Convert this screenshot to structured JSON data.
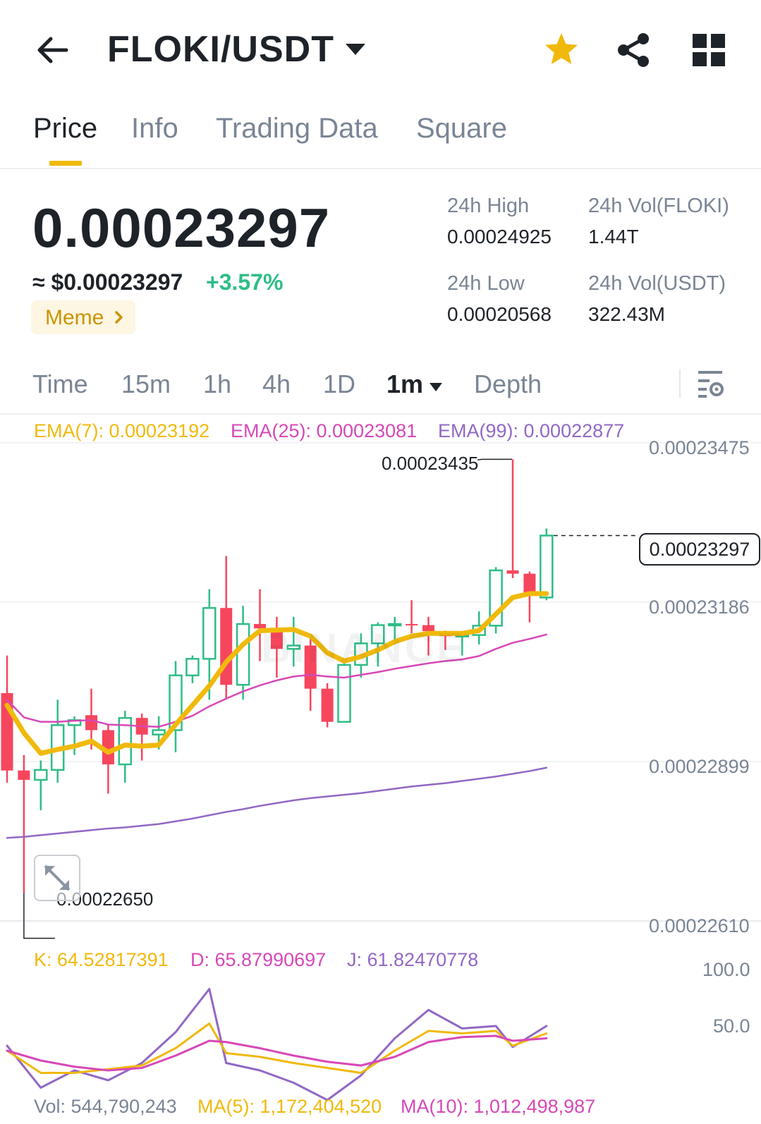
{
  "header": {
    "pair": "FLOKI/USDT",
    "icons": {
      "back": "arrow-left-icon",
      "caret": "caret-down-icon",
      "favorite": "star-icon",
      "share": "share-icon",
      "menu": "grid-icon"
    },
    "favorite_color": "#F0B90B"
  },
  "tabs": [
    {
      "label": "Price",
      "active": true
    },
    {
      "label": "Info",
      "active": false
    },
    {
      "label": "Trading Data",
      "active": false
    },
    {
      "label": "Square",
      "active": false
    }
  ],
  "ticker": {
    "last_price": "0.00023297",
    "fiat_price": "≈ $0.00023297",
    "change": "+3.57%",
    "tag": "Meme",
    "high_label": "24h High",
    "high_value": "0.00024925",
    "low_label": "24h Low",
    "low_value": "0.00020568",
    "vol_base_label": "24h Vol(FLOKI)",
    "vol_base_value": "1.44T",
    "vol_quote_label": "24h Vol(USDT)",
    "vol_quote_value": "322.43M"
  },
  "intervals": [
    {
      "label": "Time",
      "active": false
    },
    {
      "label": "15m",
      "active": false
    },
    {
      "label": "1h",
      "active": false
    },
    {
      "label": "4h",
      "active": false
    },
    {
      "label": "1D",
      "active": false
    },
    {
      "label": "1m",
      "active": true
    },
    {
      "label": "Depth",
      "active": false
    }
  ],
  "colors": {
    "up": "#2EBD85",
    "down": "#F6465D",
    "ema7": "#F0B90B",
    "ema25": "#D748B7",
    "ema99": "#9168C4",
    "k": "#F0B90B",
    "d": "#D748B7",
    "j": "#9168C4"
  },
  "chart_data": {
    "type": "candlestick",
    "watermark": "BINANCE",
    "ema_legend": {
      "ema7": "EMA(7): 0.00023192",
      "ema25": "EMA(25): 0.00023081",
      "ema99": "EMA(99): 0.00022877"
    },
    "y_ticks": [
      "0.00023475",
      "0.00023186",
      "0.00022899",
      "0.00022610"
    ],
    "y_range": [
      0.0002261,
      0.00023475
    ],
    "last_price_label": "0.00023297",
    "last_price": 0.00023297,
    "max_label": "0.00023435",
    "max_value": 0.00023435,
    "min_label": "0.00022650",
    "min_value": 0.0002265,
    "candles": [
      {
        "o": 0.00023012,
        "h": 0.0002308,
        "c": 0.00022872,
        "l": 0.0002285
      },
      {
        "o": 0.00022872,
        "h": 0.000229,
        "c": 0.00022855,
        "l": 0.0002265
      },
      {
        "o": 0.00022855,
        "h": 0.0002289,
        "c": 0.00022873,
        "l": 0.000228
      },
      {
        "o": 0.00022873,
        "h": 0.00023,
        "c": 0.00022954,
        "l": 0.0002285
      },
      {
        "o": 0.00022954,
        "h": 0.0002297,
        "c": 0.00022963,
        "l": 0.000229
      },
      {
        "o": 0.00022972,
        "h": 0.0002302,
        "c": 0.00022945,
        "l": 0.0002291
      },
      {
        "o": 0.00022945,
        "h": 0.00022955,
        "c": 0.00022883,
        "l": 0.0002283
      },
      {
        "o": 0.00022883,
        "h": 0.0002298,
        "c": 0.00022967,
        "l": 0.0002285
      },
      {
        "o": 0.00022967,
        "h": 0.00022975,
        "c": 0.00022937,
        "l": 0.0002289
      },
      {
        "o": 0.00022937,
        "h": 0.0002297,
        "c": 0.00022945,
        "l": 0.0002291
      },
      {
        "o": 0.00022945,
        "h": 0.0002307,
        "c": 0.00023044,
        "l": 0.00022905
      },
      {
        "o": 0.00023044,
        "h": 0.0002308,
        "c": 0.00023074,
        "l": 0.0002303
      },
      {
        "o": 0.00023074,
        "h": 0.000232,
        "c": 0.00023166,
        "l": 0.00023
      },
      {
        "o": 0.00023166,
        "h": 0.0002326,
        "c": 0.00023027,
        "l": 0.00023
      },
      {
        "o": 0.00023027,
        "h": 0.0002317,
        "c": 0.00023137,
        "l": 0.00023
      },
      {
        "o": 0.00023137,
        "h": 0.000232,
        "c": 0.00023129,
        "l": 0.0002307
      },
      {
        "o": 0.00023129,
        "h": 0.0002315,
        "c": 0.00023092,
        "l": 0.0002304
      },
      {
        "o": 0.00023092,
        "h": 0.0002315,
        "c": 0.00023098,
        "l": 0.0002306
      },
      {
        "o": 0.00023098,
        "h": 0.0002311,
        "c": 0.0002302,
        "l": 0.0002298
      },
      {
        "o": 0.0002302,
        "h": 0.0002303,
        "c": 0.0002296,
        "l": 0.0002295
      },
      {
        "o": 0.0002296,
        "h": 0.0002307,
        "c": 0.00023063,
        "l": 0.0002296
      },
      {
        "o": 0.00023063,
        "h": 0.0002312,
        "c": 0.00023102,
        "l": 0.0002304
      },
      {
        "o": 0.00023102,
        "h": 0.0002314,
        "c": 0.00023135,
        "l": 0.0002306
      },
      {
        "o": 0.00023135,
        "h": 0.0002315,
        "c": 0.00023137,
        "l": 0.000231
      },
      {
        "o": 0.00023137,
        "h": 0.0002318,
        "c": 0.00023136,
        "l": 0.0002312
      },
      {
        "o": 0.00023135,
        "h": 0.0002315,
        "c": 0.00023124,
        "l": 0.0002308
      },
      {
        "o": 0.00023124,
        "h": 0.00023125,
        "c": 0.00023115,
        "l": 0.0002309
      },
      {
        "o": 0.00023116,
        "h": 0.0002312,
        "c": 0.00023117,
        "l": 0.0002308
      },
      {
        "o": 0.00023117,
        "h": 0.0002316,
        "c": 0.00023134,
        "l": 0.000231
      },
      {
        "o": 0.00023134,
        "h": 0.0002324,
        "c": 0.00023234,
        "l": 0.0002312
      },
      {
        "o": 0.00023234,
        "h": 0.00023435,
        "c": 0.00023228,
        "l": 0.0002322
      },
      {
        "o": 0.00023228,
        "h": 0.00023232,
        "c": 0.00023189,
        "l": 0.0002314
      },
      {
        "o": 0.00023185,
        "h": 0.0002331,
        "c": 0.00023297,
        "l": 0.0002318
      }
    ],
    "ema7": [
      0.0002299,
      0.0002294,
      0.00022903,
      0.0002291,
      0.00022916,
      0.00022925,
      0.00022905,
      0.00022918,
      0.00022916,
      0.00022918,
      0.00022955,
      0.0002299,
      0.00023025,
      0.00023068,
      0.000231,
      0.00023125,
      0.00023126,
      0.00023127,
      0.00023115,
      0.00023085,
      0.0002307,
      0.00023078,
      0.0002309,
      0.00023105,
      0.00023115,
      0.0002312,
      0.0002312,
      0.0002312,
      0.00023125,
      0.00023155,
      0.00023185,
      0.00023192,
      0.00023192
    ],
    "ema25": [
      0.00023,
      0.00022968,
      0.0002296,
      0.0002296,
      0.00022962,
      0.00022963,
      0.00022955,
      0.00022954,
      0.00022952,
      0.00022951,
      0.0002296,
      0.00022971,
      0.00022988,
      0.00023002,
      0.00023015,
      0.00023026,
      0.00023035,
      0.00023042,
      0.00023045,
      0.00023042,
      0.0002304,
      0.00023045,
      0.0002305,
      0.00023056,
      0.00023061,
      0.00023066,
      0.0002307,
      0.00023073,
      0.00023079,
      0.00023092,
      0.00023103,
      0.0002311,
      0.00023118
    ],
    "ema99": [
      0.0002275,
      0.00022752,
      0.00022755,
      0.00022758,
      0.00022761,
      0.00022764,
      0.00022767,
      0.00022769,
      0.00022772,
      0.00022775,
      0.0002278,
      0.00022785,
      0.00022791,
      0.00022797,
      0.00022802,
      0.00022808,
      0.00022813,
      0.00022818,
      0.00022822,
      0.00022825,
      0.00022828,
      0.00022831,
      0.00022835,
      0.00022839,
      0.00022843,
      0.00022846,
      0.00022849,
      0.00022853,
      0.00022857,
      0.00022861,
      0.00022866,
      0.00022871,
      0.00022877
    ],
    "kdj_legend": {
      "k": "K: 64.52817391",
      "d": "D: 65.87990697",
      "j": "J: 61.82470778"
    },
    "kdj_ticks": [
      "100.0",
      "50.0"
    ],
    "kdj_range": [
      0,
      120
    ],
    "kdj_x_index": [
      0,
      2,
      4,
      6,
      8,
      10,
      12,
      13,
      15,
      17,
      19,
      21,
      23,
      25,
      27,
      29,
      30,
      32
    ],
    "k": [
      40,
      22,
      22,
      25,
      28,
      42,
      62,
      38,
      35,
      30,
      26,
      22,
      40,
      56,
      54,
      56,
      44,
      54
    ],
    "d": [
      40,
      32,
      27,
      24,
      26,
      36,
      48,
      47,
      42,
      36,
      31,
      28,
      35,
      47,
      51,
      52,
      48,
      50
    ],
    "j": [
      44,
      10,
      24,
      16,
      30,
      55,
      90,
      30,
      24,
      14,
      0,
      20,
      50,
      73,
      58,
      60,
      43,
      60
    ],
    "vol_legend": {
      "vol": "Vol: 544,790,243",
      "ma5": "MA(5): 1,172,404,520",
      "ma10": "MA(10): 1,012,498,987"
    }
  }
}
